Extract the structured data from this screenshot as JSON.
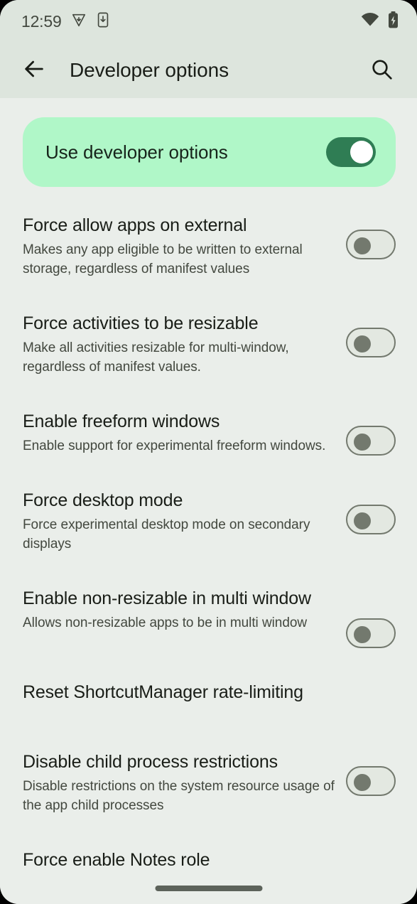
{
  "status_bar": {
    "time": "12:59",
    "icons_left": [
      "vpn-shield-icon",
      "phone-download-icon"
    ],
    "icons_right": [
      "wifi-icon",
      "battery-charging-icon"
    ]
  },
  "app_bar": {
    "back_icon": "back-arrow-icon",
    "title": "Developer options",
    "search_icon": "search-icon"
  },
  "colors": {
    "header_bg": "#dde5dd",
    "page_bg": "#eaeeea",
    "card_bg": "#b0f7c8",
    "switch_on_track": "#2f7d54",
    "switch_on_thumb": "#ffffff",
    "switch_off_track": "#e3e8e1",
    "switch_off_outline": "#73796e",
    "title_text": "#191d17",
    "desc_text": "#43483f"
  },
  "master_switch": {
    "label": "Use developer options",
    "state": "on"
  },
  "settings": [
    {
      "title": "Force allow apps on external",
      "description": "Makes any app eligible to be written to external storage, regardless of manifest values",
      "state": "off"
    },
    {
      "title": "Force activities to be resizable",
      "description": "Make all activities resizable for multi-window, regardless of manifest values.",
      "state": "off"
    },
    {
      "title": "Enable freeform windows",
      "description": "Enable support for experimental freeform windows.",
      "state": "off"
    },
    {
      "title": "Force desktop mode",
      "description": "Force experimental desktop mode on secondary displays",
      "state": "off"
    },
    {
      "title": "Enable non-resizable in multi window",
      "description": "Allows non-resizable apps to be in multi window",
      "state": "off"
    },
    {
      "title": "Reset ShortcutManager rate-limiting",
      "description": "",
      "state": "none"
    },
    {
      "title": "Disable child process restrictions",
      "description": "Disable restrictions on the system resource usage of the app child processes",
      "state": "off"
    },
    {
      "title": "Force enable Notes role",
      "description": "",
      "state": "none"
    }
  ],
  "navigation": {
    "gesture_pill": "home-gesture-pill"
  }
}
